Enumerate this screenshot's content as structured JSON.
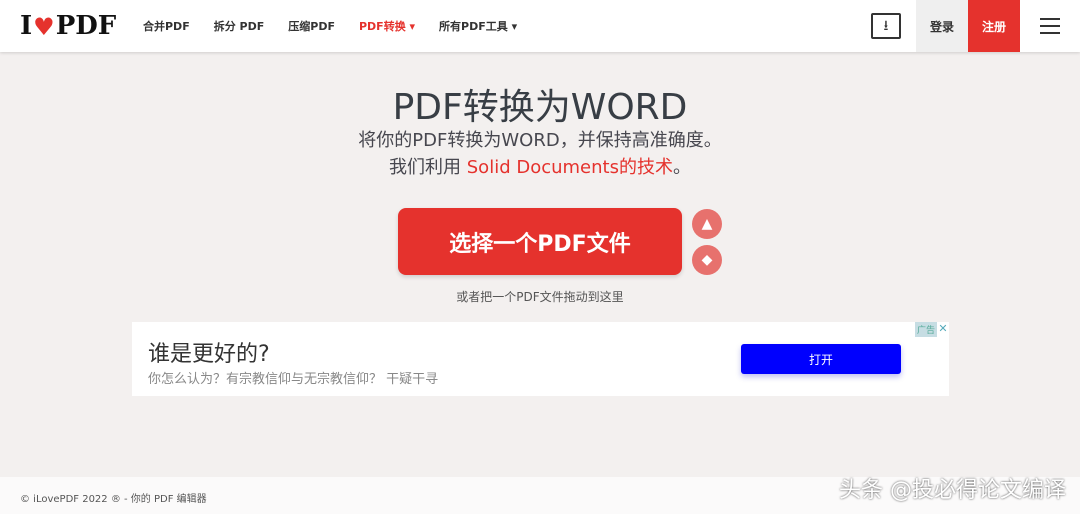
{
  "header": {
    "logo": "I♥PDF",
    "nav": [
      "合并PDF",
      "拆分 PDF",
      "压缩PDF",
      "PDF转换 ▾",
      "所有PDF工具 ▾"
    ],
    "login": "登录",
    "register": "注册"
  },
  "main": {
    "title": "PDF转换为WORD",
    "sub1": "将你的PDF转换为WORD，并保持高准确度。",
    "sub2_pre": "我们利用 ",
    "sub2_link": "Solid Documents的技术",
    "sub2_post": "。",
    "select_button": "选择一个PDF文件",
    "drop_hint": "或者把一个PDF文件拖动到这里"
  },
  "ad": {
    "title": "谁是更好的?",
    "desc": "你怎么认为？有宗教信仰与无宗教信仰？ 干疑干寻",
    "button": "打开",
    "label": "广告",
    "close": "✕"
  },
  "footer": {
    "text": "© iLovePDF 2022 ® - 你的 PDF 编辑器"
  },
  "watermark": "头条 @投必得论文编译",
  "colors": {
    "brand": "#e5322d",
    "ad_button": "#0000fe"
  }
}
